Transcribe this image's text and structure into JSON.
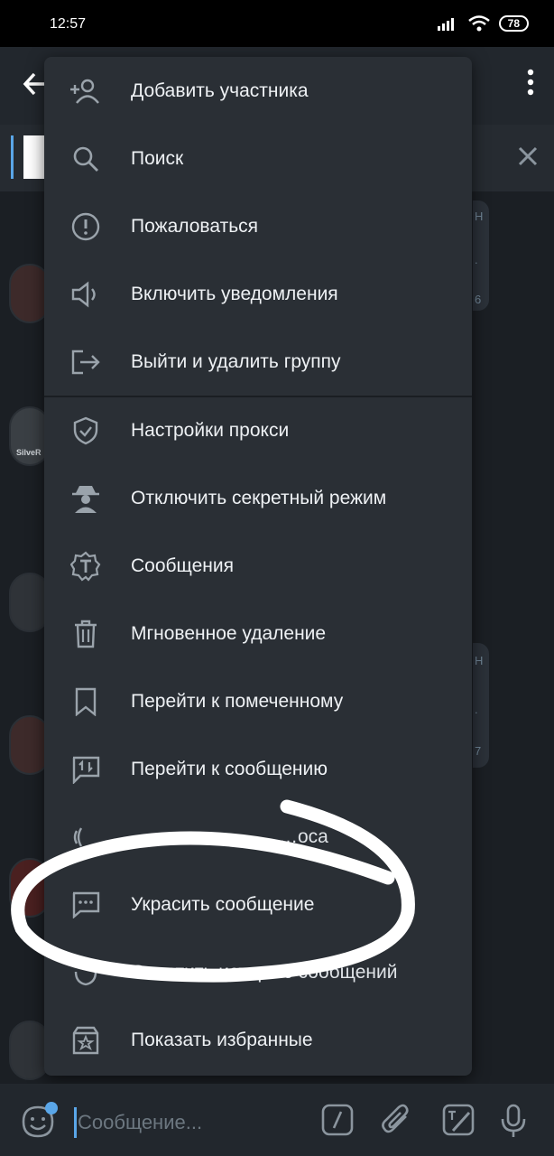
{
  "status_bar": {
    "time": "12:57",
    "battery": "78"
  },
  "menu": {
    "items": [
      {
        "label": "Добавить участника",
        "icon": "add-user-icon"
      },
      {
        "label": "Поиск",
        "icon": "search-icon"
      },
      {
        "label": "Пожаловаться",
        "icon": "report-icon"
      },
      {
        "label": "Включить уведомления",
        "icon": "speaker-icon"
      },
      {
        "label": "Выйти и удалить группу",
        "icon": "leave-icon"
      },
      {
        "label": "Настройки прокси",
        "icon": "shield-icon"
      },
      {
        "label": "Отключить секретный режим",
        "icon": "incognito-icon"
      },
      {
        "label": "Сообщения",
        "icon": "gear-text-icon"
      },
      {
        "label": "Мгновенное удаление",
        "icon": "trash-icon"
      },
      {
        "label": "Перейти к помеченному",
        "icon": "bookmark-icon"
      },
      {
        "label": "Перейти к сообщению",
        "icon": "jump-message-icon"
      },
      {
        "label": "…оса",
        "icon": "voice-icon"
      },
      {
        "label": "Украсить сообщение",
        "icon": "chat-dots-icon"
      },
      {
        "label": "Очистить историю сообщений",
        "icon": "clear-icon"
      },
      {
        "label": "Показать избранные",
        "icon": "favorites-icon"
      }
    ]
  },
  "chat": {
    "avatar_label": "SilveR",
    "bubble_marks": [
      "Н",
      ".",
      "6",
      "Н",
      ".",
      "7"
    ]
  },
  "pinned": {
    "preview_text": "…"
  },
  "input": {
    "placeholder": "Сообщение..."
  },
  "colors": {
    "accent": "#5aa6e8",
    "menu_bg": "#2a2f35"
  }
}
